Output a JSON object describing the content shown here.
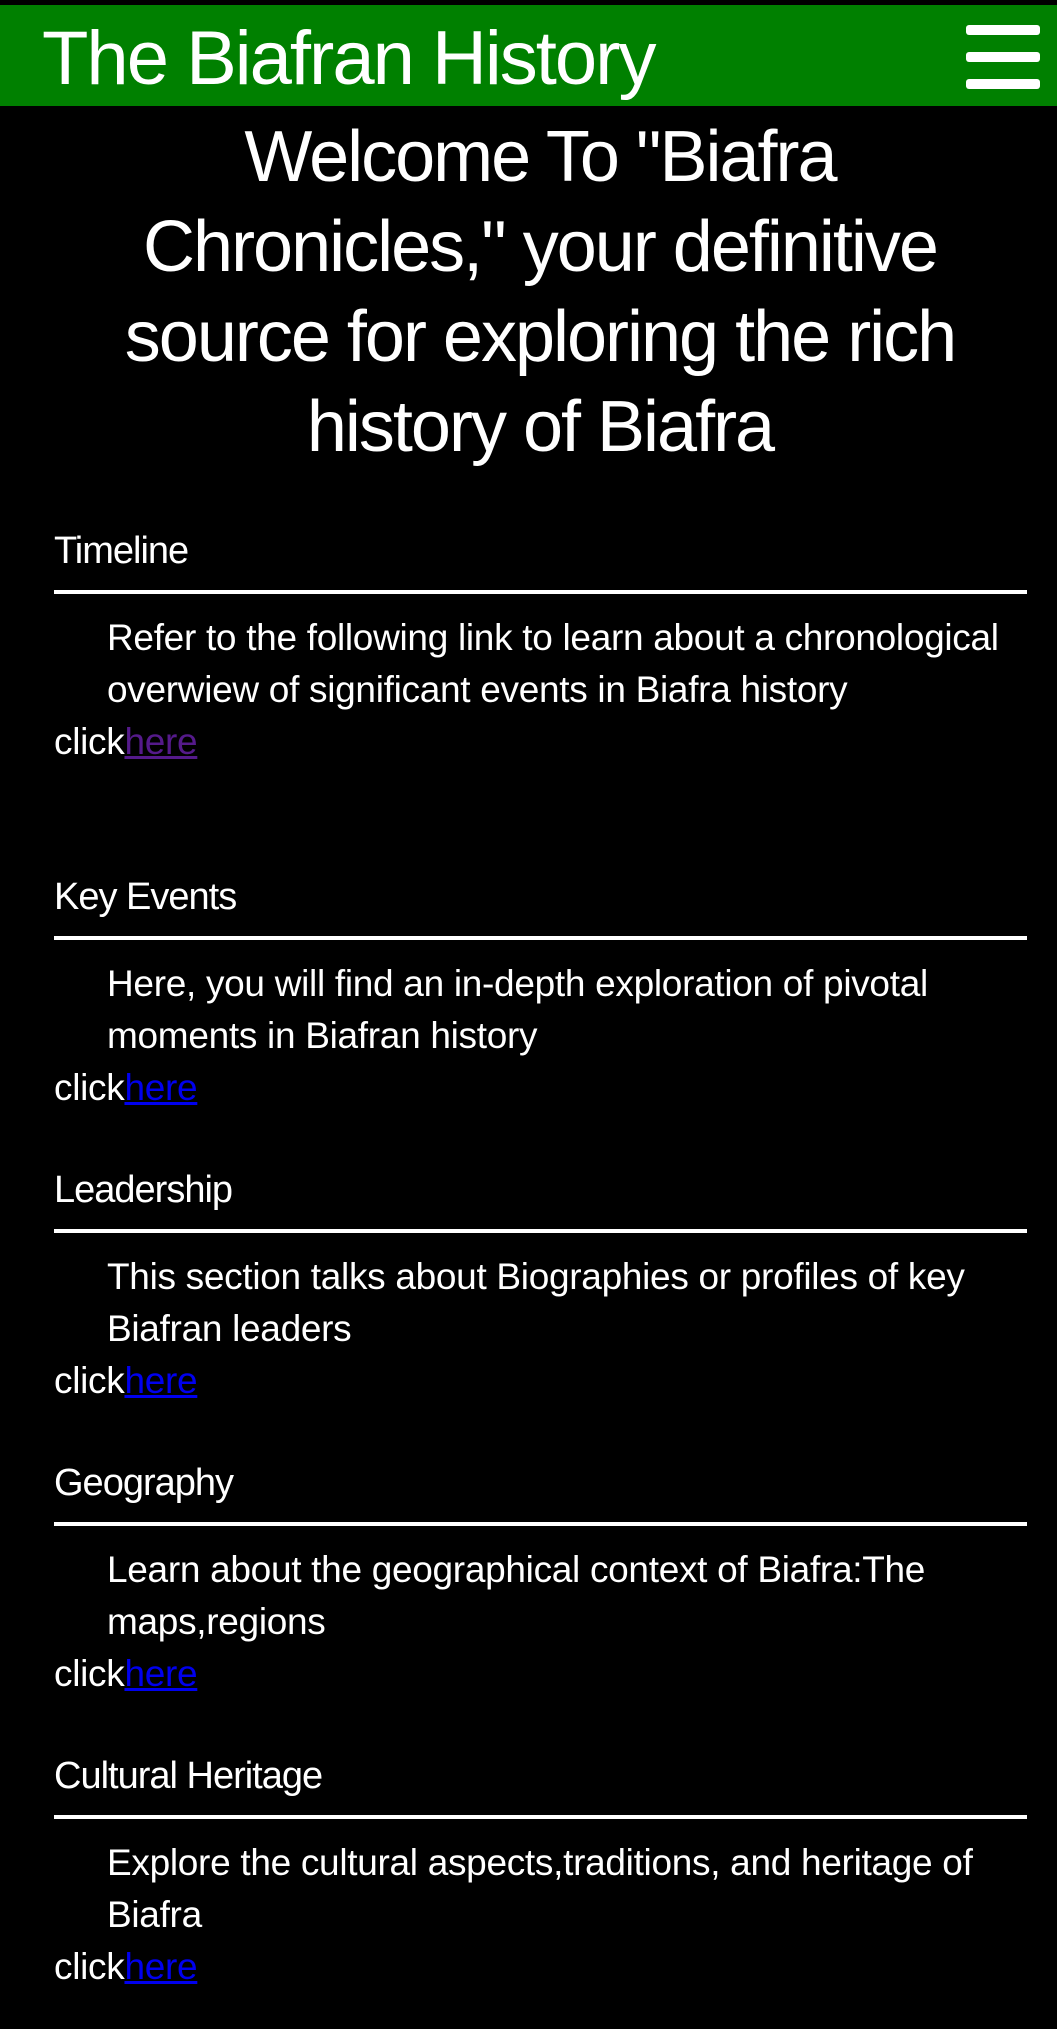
{
  "header": {
    "title": "The Biafran History",
    "menu_icon": "hamburger-menu-icon",
    "background_color": "#008000"
  },
  "welcome": {
    "text": "Welcome To \"Biafra Chronicles,\" your definitive source for exploring the rich history of Biafra"
  },
  "sections": [
    {
      "heading": "Timeline",
      "description": "Refer to the following link to learn about a chronological overwiew of significant events in Biafra history",
      "click_text": "click",
      "link_text": "here",
      "link_color": "#551a8b"
    },
    {
      "heading": "Key Events",
      "description": "Here, you will find an in-depth exploration of pivotal moments in Biafran history",
      "click_text": "click",
      "link_text": "here",
      "link_color": "#0000ee"
    },
    {
      "heading": "Leadership",
      "description": "This section talks about Biographies or profiles of key Biafran leaders",
      "click_text": "click",
      "link_text": "here",
      "link_color": "#0000ee"
    },
    {
      "heading": "Geography",
      "description": "Learn about the geographical context of Biafra:The maps,regions",
      "click_text": "click",
      "link_text": "here",
      "link_color": "#0000ee"
    },
    {
      "heading": "Cultural Heritage",
      "description": "Explore the cultural aspects,traditions, and heritage of Biafra",
      "click_text": "click",
      "link_text": "here",
      "link_color": "#0000ee"
    }
  ]
}
